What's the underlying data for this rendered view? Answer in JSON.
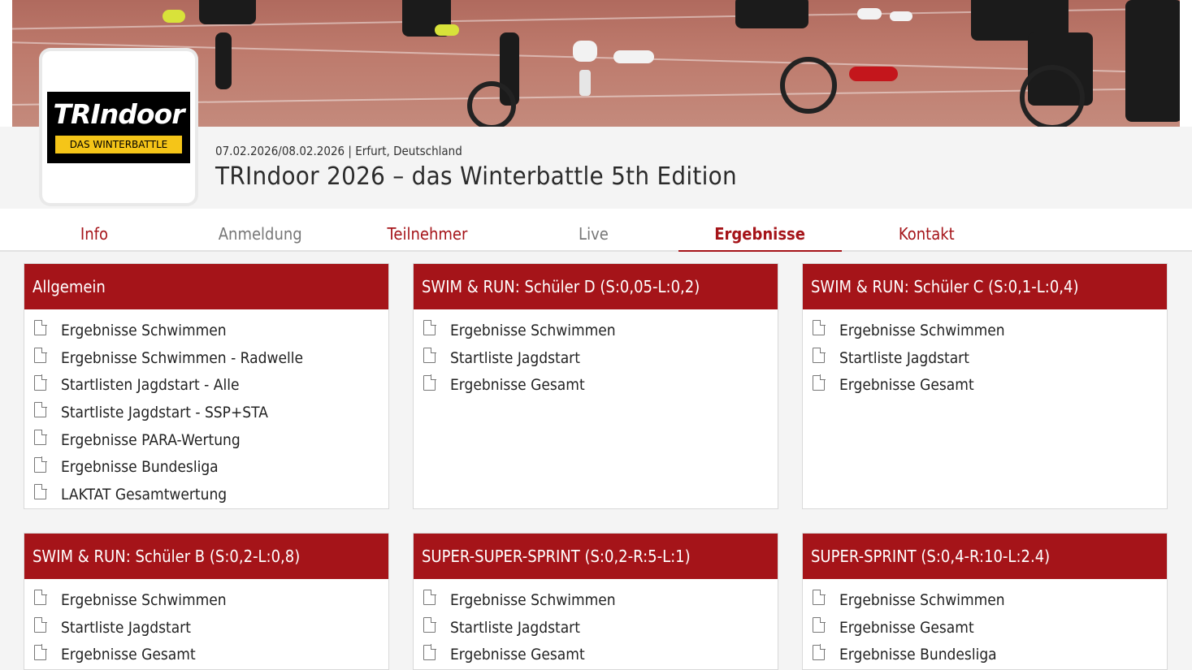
{
  "event": {
    "meta": "07.02.2026/08.02.2026 | Erfurt, Deutschland",
    "title": "TRIndoor 2026 – das Winterbattle 5th Edition",
    "logo_word": "TRIndoor",
    "logo_band": "DAS WINTERBATTLE"
  },
  "tabs": [
    {
      "label": "Info",
      "state": "link"
    },
    {
      "label": "Anmeldung",
      "state": "disabled"
    },
    {
      "label": "Teilnehmer",
      "state": "link"
    },
    {
      "label": "Live",
      "state": "disabled"
    },
    {
      "label": "Ergebnisse",
      "state": "active"
    },
    {
      "label": "Kontakt",
      "state": "link"
    }
  ],
  "cards": [
    {
      "title": "Allgemein",
      "items": [
        "Ergebnisse Schwimmen",
        "Ergebnisse Schwimmen - Radwelle",
        "Startlisten Jagdstart - Alle",
        "Startliste Jagdstart - SSP+STA",
        "Ergebnisse PARA-Wertung",
        "Ergebnisse Bundesliga",
        "LAKTAT Gesamtwertung"
      ]
    },
    {
      "title": "SWIM & RUN: Schüler D (S:0,05-L:0,2)",
      "items": [
        "Ergebnisse Schwimmen",
        "Startliste Jagdstart",
        "Ergebnisse Gesamt"
      ]
    },
    {
      "title": "SWIM & RUN: Schüler C (S:0,1-L:0,4)",
      "items": [
        "Ergebnisse Schwimmen",
        "Startliste Jagdstart",
        "Ergebnisse Gesamt"
      ]
    },
    {
      "title": "SWIM & RUN: Schüler B (S:0,2-L:0,8)",
      "items": [
        "Ergebnisse Schwimmen",
        "Startliste Jagdstart",
        "Ergebnisse Gesamt"
      ]
    },
    {
      "title": "SUPER-SUPER-SPRINT (S:0,2-R:5-L:1)",
      "items": [
        "Ergebnisse Schwimmen",
        "Startliste Jagdstart",
        "Ergebnisse Gesamt"
      ]
    },
    {
      "title": "SUPER-SPRINT (S:0,4-R:10-L:2.4)",
      "items": [
        "Ergebnisse Schwimmen",
        "Ergebnisse Gesamt",
        "Ergebnisse Bundesliga"
      ]
    }
  ],
  "colors": {
    "accent": "#a51419",
    "disabled_tab": "#777777",
    "background": "#f4f4f4"
  },
  "icons": {
    "list_item": "document-icon"
  }
}
